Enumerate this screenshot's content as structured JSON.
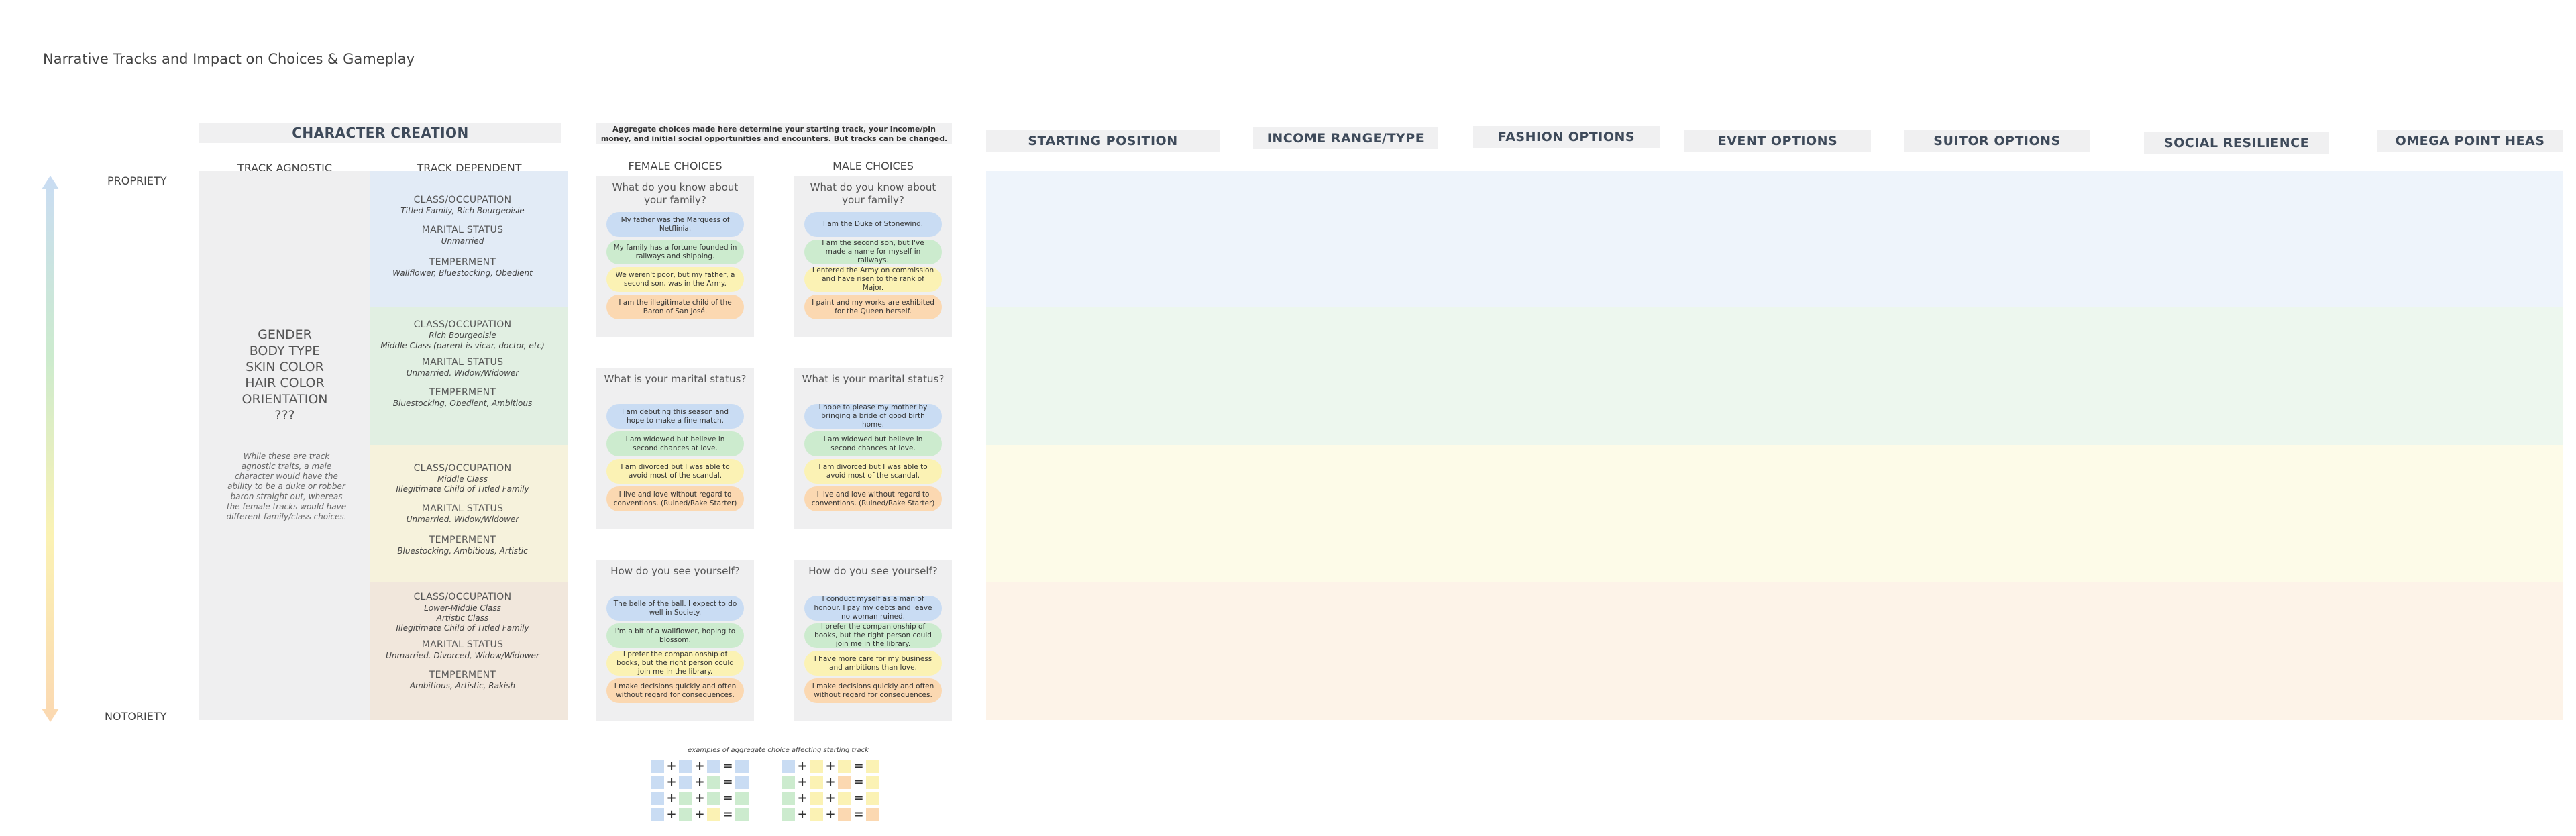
{
  "title": "Narrative Tracks and Impact on Choices & Gameplay",
  "character_creation": {
    "header": "CHARACTER CREATION",
    "track_agnostic_label": "TRACK AGNOSTIC",
    "track_dependent_label": "TRACK DEPENDENT",
    "agnostic_traits": [
      "GENDER",
      "BODY TYPE",
      "SKIN COLOR",
      "HAIR COLOR",
      "ORIENTATION",
      "???"
    ],
    "agnostic_note": "While these are track agnostic traits, a male character would have the ability to be a duke or robber baron straight out, whereas the female tracks would have different family/class choices.",
    "tracks": [
      {
        "class_label": "CLASS/OCCUPATION",
        "class_value": "Titled Family, Rich Bourgeoisie",
        "marital_label": "MARITAL STATUS",
        "marital_value": "Unmarried",
        "temperament_label": "TEMPERMENT",
        "temperament_value": "Wallflower, Bluestocking, Obedient"
      },
      {
        "class_label": "CLASS/OCCUPATION",
        "class_value": "Rich Bourgeoisie\nMiddle Class (parent is vicar, doctor, etc)",
        "marital_label": "MARITAL STATUS",
        "marital_value": "Unmarried. Widow/Widower",
        "temperament_label": "TEMPERMENT",
        "temperament_value": "Bluestocking, Obedient, Ambitious"
      },
      {
        "class_label": "CLASS/OCCUPATION",
        "class_value": "Middle Class\nIllegitimate Child of Titled Family",
        "marital_label": "MARITAL STATUS",
        "marital_value": "Unmarried. Widow/Widower",
        "temperament_label": "TEMPERMENT",
        "temperament_value": "Bluestocking, Ambitious, Artistic"
      },
      {
        "class_label": "CLASS/OCCUPATION",
        "class_value": "Lower-Middle Class\nArtistic Class\nIllegitimate Child of Titled Family",
        "marital_label": "MARITAL STATUS",
        "marital_value": "Unmarried. Divorced, Widow/Widower",
        "temperament_label": "TEMPERMENT",
        "temperament_value": "Ambitious, Artistic, Rakish"
      }
    ]
  },
  "axis": {
    "top": "PROPRIETY",
    "bottom": "NOTORIETY"
  },
  "aggregate_note": "Aggregate choices made here determine your starting track, your income/pin money, and initial social opportunities and encounters. But tracks can be changed.",
  "female_label": "FEMALE  CHOICES",
  "male_label": "MALE  CHOICES",
  "female_questions": [
    {
      "q": "What do you know about your family?",
      "answers": [
        "My father was the Marquess of Netflinia.",
        "My family has a fortune founded in railways and shipping.",
        "We weren't poor, but my father, a second son, was in the Army.",
        "I am the illegitimate child of the Baron of San José."
      ]
    },
    {
      "q": "What is your marital status?",
      "answers": [
        "I am debuting this season and hope to make a fine match.",
        "I am widowed but believe in second chances at love.",
        "I am divorced but I was able to avoid most of the scandal.",
        "I live and love without regard to conventions. (Ruined/Rake Starter)"
      ]
    },
    {
      "q": "How do you see yourself?",
      "answers": [
        "The belle of the ball. I expect to do well in Society.",
        "I'm a bit of a wallflower, hoping to blossom.",
        "I prefer the companionship of books, but the right person could join me in the library.",
        "I make decisions quickly and often without regard for consequences."
      ]
    }
  ],
  "male_questions": [
    {
      "q": "What do you know about your family?",
      "answers": [
        "I am the Duke of Stonewind.",
        "I am the second son, but I've made a name for myself in railways.",
        "I entered the Army on commission and have risen to the rank of Major.",
        "I paint and my works are exhibited for the Queen herself."
      ]
    },
    {
      "q": "What is your marital status?",
      "answers": [
        "I hope to please my mother by bringing a bride of good birth home.",
        "I am widowed but believe in second chances at love.",
        "I am divorced but I was able to avoid most of the scandal.",
        "I live and love without regard to conventions. (Ruined/Rake Starter)"
      ]
    },
    {
      "q": "How do you see yourself?",
      "answers": [
        "I conduct myself as a man of honour. I pay my debts and leave no woman ruined.",
        "I prefer the companionship of books, but the right person could join me in the library.",
        "I have more care for my business and ambitions than love.",
        "I make decisions quickly and often without regard for consequences."
      ]
    }
  ],
  "columns": [
    "STARTING POSITION",
    "INCOME RANGE/TYPE",
    "FASHION OPTIONS",
    "EVENT OPTIONS",
    "SUITOR OPTIONS",
    "SOCIAL RESILIENCE",
    "OMEGA POINT HEAS"
  ],
  "examples": {
    "title": "examples of aggregate choice affecting starting track",
    "operators": [
      "+",
      "+",
      "="
    ],
    "left": [
      [
        "blue",
        "blue",
        "blue",
        "blue"
      ],
      [
        "blue",
        "blue",
        "green",
        "blue"
      ],
      [
        "blue",
        "green",
        "green",
        "green"
      ],
      [
        "blue",
        "green",
        "yellow",
        "green"
      ]
    ],
    "right": [
      [
        "blue",
        "yellow",
        "yellow",
        "yellow"
      ],
      [
        "green",
        "yellow",
        "orange",
        "yellow"
      ],
      [
        "green",
        "yellow",
        "yellow",
        "yellow"
      ],
      [
        "green",
        "yellow",
        "orange",
        "orange"
      ]
    ]
  },
  "colors": {
    "blue": "#c9dcf3",
    "green": "#ccebce",
    "yellow": "#fbf2b4",
    "orange": "#fbd8b1",
    "band_blue": "#eef4fb",
    "band_green": "#edf7ee",
    "band_yellow": "#fdfbe8",
    "band_orange": "#fdf3e8"
  }
}
